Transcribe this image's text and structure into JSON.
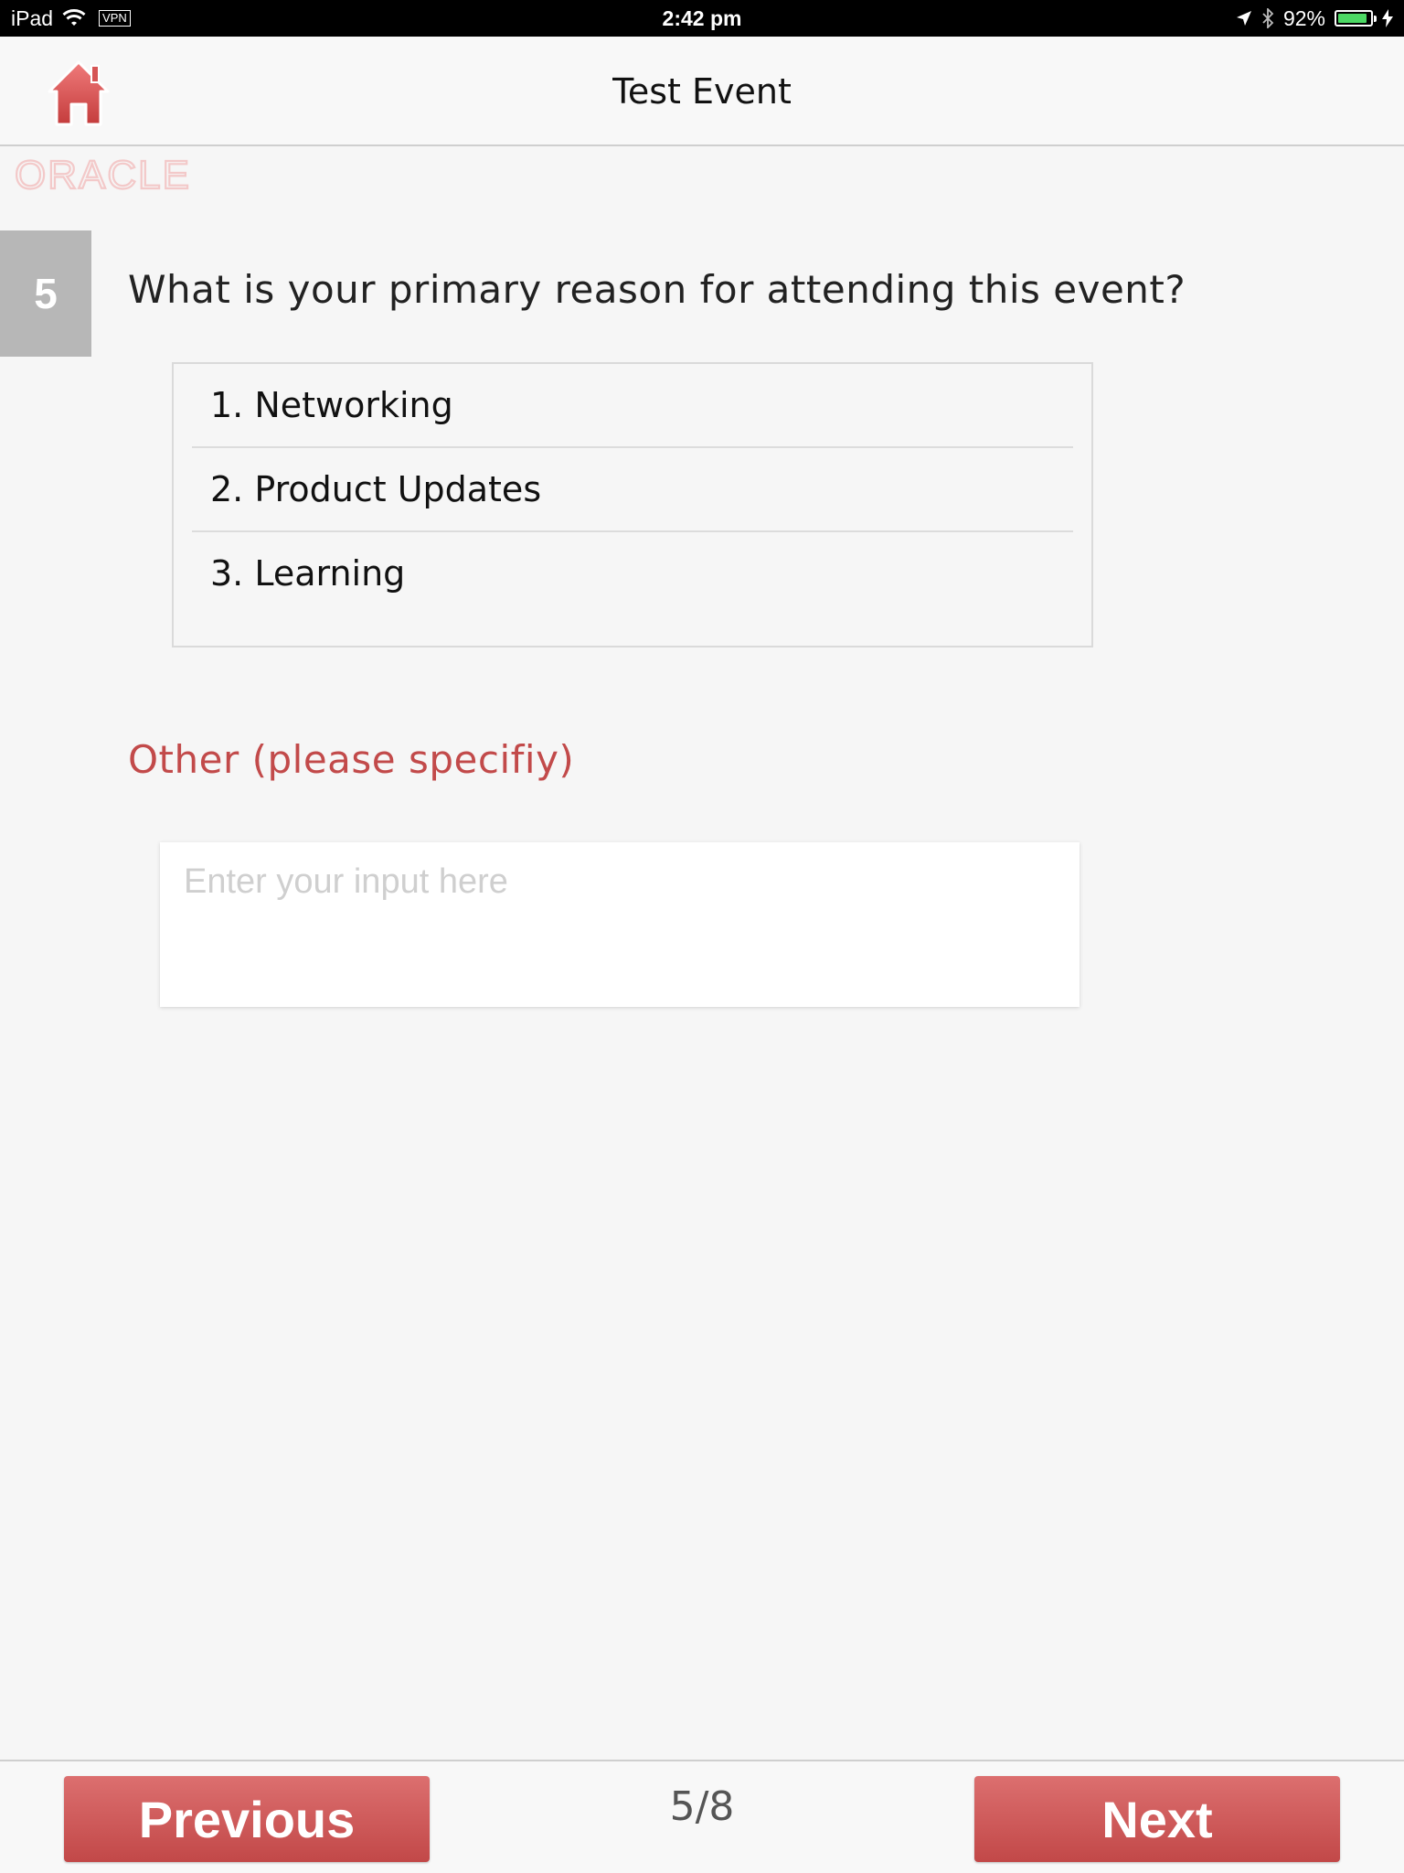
{
  "status_bar": {
    "device": "iPad",
    "vpn": "VPN",
    "time": "2:42 pm",
    "battery_text": "92%",
    "battery_level": 0.92,
    "battery_color": "#4cd964"
  },
  "header": {
    "title": "Test Event",
    "home_icon": "home-icon",
    "logo_text": "ORACLE"
  },
  "question": {
    "number": "5",
    "text": "What is your primary reason for attending this event?",
    "options": [
      "1. Networking",
      "2. Product Updates",
      "3. Learning"
    ],
    "other_label": "Other (please specifiy)",
    "other_placeholder": "Enter your input here"
  },
  "footer": {
    "previous_label": "Previous",
    "next_label": "Next",
    "page_indicator": "5/8"
  },
  "colors": {
    "accent": "#c24a4a",
    "button_top": "#dc6f6f",
    "button_bottom": "#c24848"
  }
}
